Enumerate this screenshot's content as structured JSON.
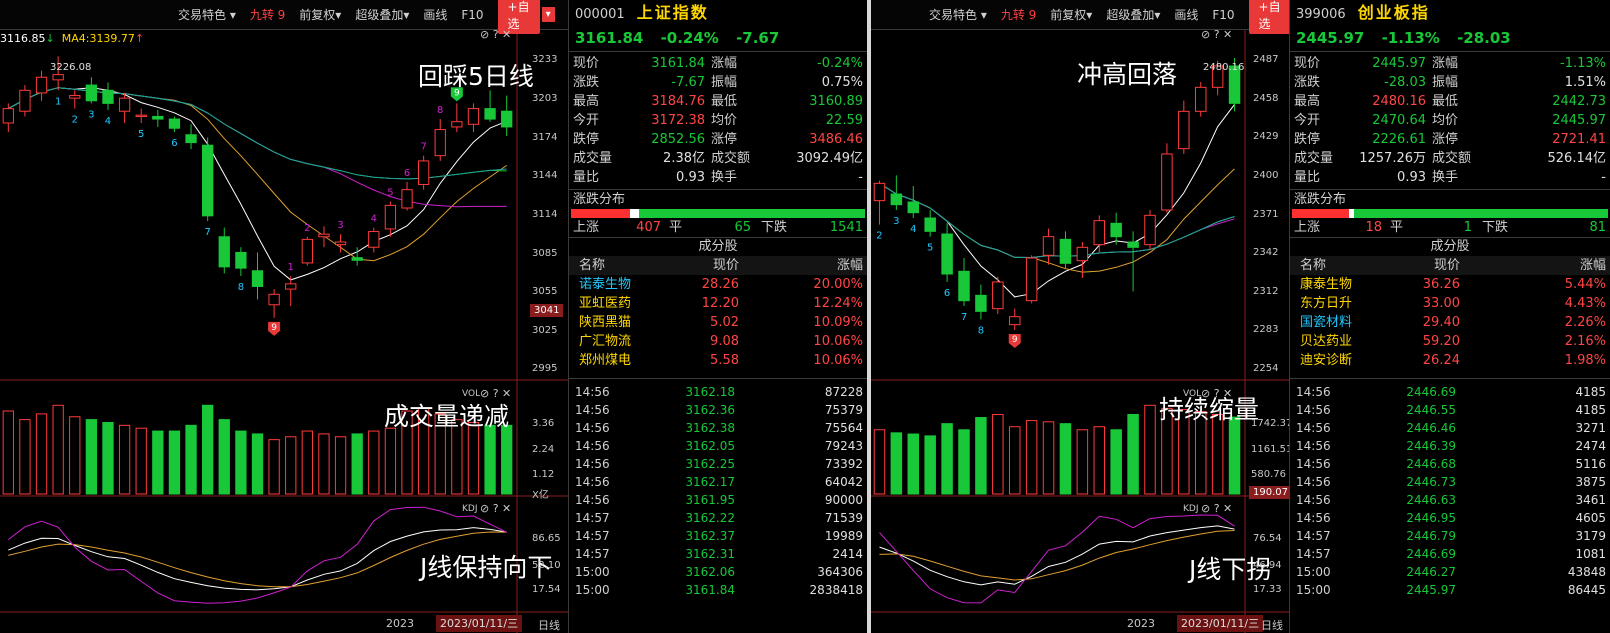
{
  "panes": [
    {
      "toolbar": {
        "items": [
          "交易特色 ▾",
          "九转 9",
          "前复权▾",
          "超级叠加▾",
          "画线",
          "F10"
        ],
        "zixuan": "+自选",
        "arrow": "▾"
      },
      "ma_info": {
        "ma1": "3116.85",
        "ma1_arrow": "↓",
        "ma2": "MA4:3139.77",
        "ma2_arrow": "↑"
      },
      "high_label": "3226.08",
      "annotations": {
        "price": "回踩5日线",
        "vol": "成交量递减",
        "kdj": "J线保持向下"
      },
      "price_axis": [
        "3233",
        "3203",
        "3174",
        "3144",
        "3114",
        "3085",
        "3055",
        "3025",
        "2995"
      ],
      "price_axis_box": "3041",
      "vol_title": "VOL",
      "vol_axis": [
        "3.36",
        "2.24",
        "1.12",
        "X亿"
      ],
      "kdj_title": "KDJ",
      "kdj_axis": [
        "86.65",
        "52.10",
        "17.54"
      ],
      "year": "2023",
      "date": "2023/01/11/三",
      "period": "日线",
      "controls": "⊘ ? ✕",
      "side": {
        "code": "000001",
        "name": "上证指数",
        "price": "3161.84",
        "pct": "-0.24%",
        "chg": "-7.67",
        "stats": [
          [
            "现价",
            "3161.84",
            "g",
            "涨幅",
            "-0.24%",
            "g"
          ],
          [
            "涨跌",
            "-7.67",
            "g",
            "振幅",
            "0.75%",
            "w"
          ],
          [
            "最高",
            "3184.76",
            "r",
            "最低",
            "3160.89",
            "g"
          ],
          [
            "今开",
            "3172.38",
            "r",
            "均价",
            "22.59",
            "g"
          ],
          [
            "跌停",
            "2852.56",
            "g",
            "涨停",
            "3486.46",
            "r"
          ],
          [
            "成交量",
            "2.38亿",
            "w",
            "成交额",
            "3092.49亿",
            "w"
          ],
          [
            "量比",
            "0.93",
            "w",
            "换手",
            "-",
            "w"
          ]
        ],
        "dist_title": "涨跌分布",
        "dist": {
          "up_label": "上涨",
          "up": "407",
          "flat_label": "平",
          "flat": "65",
          "down_label": "下跌",
          "down": "1541",
          "up_frac": 0.2,
          "flat_frac": 0.03
        },
        "cfg_title": "成分股",
        "cfg_head": [
          "名称",
          "现价",
          "涨幅"
        ],
        "cfg": [
          [
            "诺泰生物",
            "28.26",
            "20.00%",
            "c"
          ],
          [
            "亚虹医药",
            "12.20",
            "12.24%",
            "y"
          ],
          [
            "陕西黑猫",
            "5.02",
            "10.09%",
            "y"
          ],
          [
            "广汇物流",
            "9.08",
            "10.06%",
            "y"
          ],
          [
            "郑州煤电",
            "5.58",
            "10.06%",
            "y"
          ]
        ],
        "trades": [
          [
            "14:56",
            "3162.18",
            "87228"
          ],
          [
            "14:56",
            "3162.36",
            "75379"
          ],
          [
            "14:56",
            "3162.38",
            "75564"
          ],
          [
            "14:56",
            "3162.05",
            "79243"
          ],
          [
            "14:56",
            "3162.25",
            "73392"
          ],
          [
            "14:56",
            "3162.17",
            "64042"
          ],
          [
            "14:56",
            "3161.95",
            "90000"
          ],
          [
            "14:57",
            "3162.22",
            "71539"
          ],
          [
            "14:57",
            "3162.37",
            "19989"
          ],
          [
            "14:57",
            "3162.31",
            "2414"
          ],
          [
            "15:00",
            "3162.06",
            "364306"
          ],
          [
            "15:00",
            "3161.84",
            "2838418"
          ]
        ]
      }
    },
    {
      "toolbar": {
        "items": [
          "交易特色 ▾",
          "九转 9",
          "前复权▾",
          "超级叠加▾",
          "画线",
          "F10"
        ],
        "zixuan": "+自选",
        "arrow": "▾"
      },
      "ma_info": {
        "ma1": "",
        "ma1_arrow": "",
        "ma2": "",
        "ma2_arrow": ""
      },
      "high_label": "2480.16",
      "annotations": {
        "price": "冲高回落",
        "vol": "持续缩量",
        "kdj": "J线下拐"
      },
      "price_axis": [
        "2487",
        "2458",
        "2429",
        "2400",
        "2371",
        "2342",
        "2312",
        "2283",
        "2254"
      ],
      "price_axis_box": "",
      "vol_title": "VOL",
      "vol_axis": [
        "1742.37",
        "1161.51",
        "580.76"
      ],
      "vol_axis_box": "190.07",
      "kdj_title": "KDJ",
      "kdj_axis": [
        "76.54",
        "46.94",
        "17.33"
      ],
      "year": "2023",
      "date": "2023/01/11/三",
      "period": "日线",
      "controls": "⊘ ? ✕",
      "side": {
        "code": "399006",
        "name": "创业板指",
        "price": "2445.97",
        "pct": "-1.13%",
        "chg": "-28.03",
        "stats": [
          [
            "现价",
            "2445.97",
            "g",
            "涨幅",
            "-1.13%",
            "g"
          ],
          [
            "涨跌",
            "-28.03",
            "g",
            "振幅",
            "1.51%",
            "w"
          ],
          [
            "最高",
            "2480.16",
            "r",
            "最低",
            "2442.73",
            "g"
          ],
          [
            "今开",
            "2470.64",
            "g",
            "均价",
            "2445.97",
            "g"
          ],
          [
            "跌停",
            "2226.61",
            "g",
            "涨停",
            "2721.41",
            "r"
          ],
          [
            "成交量",
            "1257.26万",
            "w",
            "成交额",
            "526.14亿",
            "w"
          ],
          [
            "量比",
            "0.93",
            "w",
            "换手",
            "-",
            "w"
          ]
        ],
        "dist_title": "涨跌分布",
        "dist": {
          "up_label": "上涨",
          "up": "18",
          "flat_label": "平",
          "flat": "1",
          "down_label": "下跌",
          "down": "81",
          "up_frac": 0.18,
          "flat_frac": 0.01
        },
        "cfg_title": "成分股",
        "cfg_head": [
          "名称",
          "现价",
          "涨幅"
        ],
        "cfg": [
          [
            "康泰生物",
            "36.26",
            "5.44%",
            "y"
          ],
          [
            "东方日升",
            "33.00",
            "4.43%",
            "y"
          ],
          [
            "国瓷材料",
            "29.40",
            "2.26%",
            "c"
          ],
          [
            "贝达药业",
            "59.20",
            "2.16%",
            "y"
          ],
          [
            "迪安诊断",
            "26.24",
            "1.98%",
            "y"
          ]
        ],
        "trades": [
          [
            "14:56",
            "2446.69",
            "4185"
          ],
          [
            "14:56",
            "2446.55",
            "4185"
          ],
          [
            "14:56",
            "2446.46",
            "3271"
          ],
          [
            "14:56",
            "2446.39",
            "2474"
          ],
          [
            "14:56",
            "2446.68",
            "5116"
          ],
          [
            "14:56",
            "2446.73",
            "3875"
          ],
          [
            "14:56",
            "2446.63",
            "3461"
          ],
          [
            "14:56",
            "2446.95",
            "4605"
          ],
          [
            "14:57",
            "2446.79",
            "3179"
          ],
          [
            "14:57",
            "2446.69",
            "1081"
          ],
          [
            "15:00",
            "2446.27",
            "43848"
          ],
          [
            "15:00",
            "2445.97",
            "86445"
          ]
        ]
      }
    }
  ],
  "chart_data": [
    {
      "type": "candlestick",
      "series_name": "上证指数",
      "price_range": [
        2980,
        3240
      ],
      "candles": [
        [
          3175,
          3190,
          3168,
          3186
        ],
        [
          3184,
          3204,
          3180,
          3200
        ],
        [
          3198,
          3215,
          3192,
          3210
        ],
        [
          3208,
          3226,
          3200,
          3212
        ],
        [
          3194,
          3200,
          3186,
          3196
        ],
        [
          3204,
          3210,
          3190,
          3192
        ],
        [
          3200,
          3206,
          3185,
          3190
        ],
        [
          3184,
          3198,
          3175,
          3194
        ],
        [
          3180,
          3186,
          3175,
          3181
        ],
        [
          3180,
          3185,
          3172,
          3178
        ],
        [
          3178,
          3180,
          3168,
          3171
        ],
        [
          3166,
          3174,
          3155,
          3160
        ],
        [
          3158,
          3164,
          3100,
          3104
        ],
        [
          3088,
          3095,
          3060,
          3065
        ],
        [
          3076,
          3080,
          3058,
          3064
        ],
        [
          3062,
          3076,
          3040,
          3050
        ],
        [
          3036,
          3048,
          3026,
          3044
        ],
        [
          3048,
          3058,
          3035,
          3052
        ],
        [
          3068,
          3088,
          3066,
          3086
        ],
        [
          3088,
          3096,
          3080,
          3090
        ],
        [
          3082,
          3090,
          3076,
          3084
        ],
        [
          3072,
          3080,
          3066,
          3070
        ],
        [
          3080,
          3095,
          3076,
          3092
        ],
        [
          3094,
          3115,
          3088,
          3112
        ],
        [
          3110,
          3130,
          3108,
          3124
        ],
        [
          3128,
          3150,
          3124,
          3146
        ],
        [
          3150,
          3178,
          3146,
          3170
        ],
        [
          3172,
          3190,
          3168,
          3176
        ],
        [
          3174,
          3190,
          3168,
          3186
        ],
        [
          3186,
          3200,
          3176,
          3178
        ],
        [
          3184,
          3196,
          3165,
          3172
        ]
      ],
      "volume": [
        2.9,
        2.6,
        2.8,
        3.1,
        2.7,
        2.6,
        2.5,
        2.4,
        2.3,
        2.2,
        2.2,
        2.4,
        3.1,
        2.6,
        2.2,
        2.1,
        1.9,
        2.0,
        2.2,
        2.1,
        2.0,
        2.1,
        2.2,
        2.3,
        2.9,
        3.0,
        2.8,
        2.6,
        2.5,
        2.4,
        2.4
      ],
      "td_labels": [
        "1",
        "2",
        "3",
        "4",
        "5",
        "6",
        "7",
        "8",
        "9",
        "1",
        "2",
        "3",
        "4",
        "5",
        "6",
        "7",
        "8",
        "9"
      ]
    },
    {
      "type": "candlestick",
      "series_name": "创业板指",
      "price_range": [
        2240,
        2495
      ],
      "candles": [
        [
          2373,
          2388,
          2355,
          2386
        ],
        [
          2378,
          2392,
          2366,
          2370
        ],
        [
          2372,
          2384,
          2360,
          2364
        ],
        [
          2360,
          2366,
          2346,
          2350
        ],
        [
          2348,
          2356,
          2312,
          2318
        ],
        [
          2320,
          2330,
          2294,
          2298
        ],
        [
          2302,
          2310,
          2284,
          2290
        ],
        [
          2292,
          2316,
          2288,
          2312
        ],
        [
          2280,
          2292,
          2276,
          2286
        ],
        [
          2298,
          2332,
          2296,
          2330
        ],
        [
          2332,
          2352,
          2325,
          2346
        ],
        [
          2344,
          2350,
          2322,
          2326
        ],
        [
          2328,
          2342,
          2315,
          2338
        ],
        [
          2340,
          2362,
          2334,
          2358
        ],
        [
          2356,
          2364,
          2340,
          2346
        ],
        [
          2342,
          2350,
          2305,
          2338
        ],
        [
          2340,
          2366,
          2336,
          2362
        ],
        [
          2366,
          2416,
          2364,
          2408
        ],
        [
          2412,
          2448,
          2408,
          2440
        ],
        [
          2440,
          2462,
          2436,
          2458
        ],
        [
          2458,
          2478,
          2452,
          2474
        ],
        [
          2474,
          2480,
          2440,
          2446
        ]
      ],
      "volume": [
        1050,
        1000,
        980,
        950,
        1150,
        1050,
        1250,
        1300,
        1100,
        1200,
        1180,
        1150,
        1050,
        1100,
        1050,
        1300,
        1450,
        1400,
        1380,
        1350,
        1300,
        1257
      ],
      "td_labels": [
        "2",
        "3",
        "4",
        "5",
        "6",
        "7",
        "8",
        "9"
      ]
    }
  ]
}
